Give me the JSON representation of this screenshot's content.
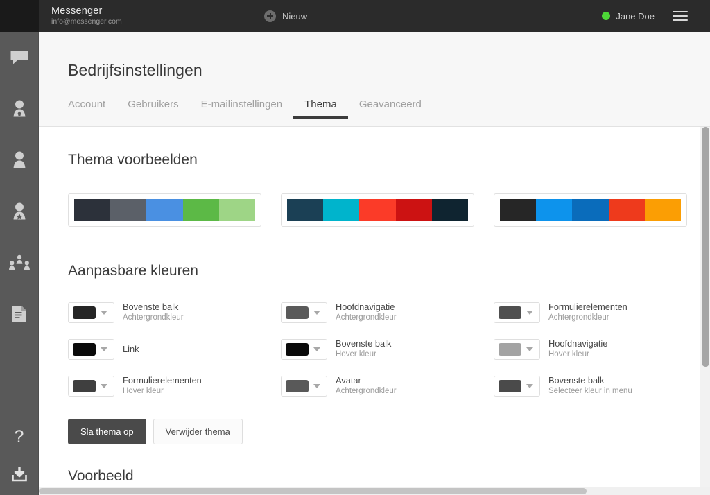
{
  "topbar": {
    "brand_title": "Messenger",
    "brand_email": "info@messenger.com",
    "new_button_label": "Nieuw",
    "new_button_icon": "plus-circle-icon",
    "user_name": "Jane Doe",
    "status_color": "#4dd637",
    "menu_icon": "hamburger-icon",
    "background": "#2b2b2b"
  },
  "sidebar": {
    "background": "#595959",
    "items": [
      {
        "name": "chat-icon",
        "label": "Gesprekken"
      },
      {
        "name": "user-badge-icon",
        "label": "Contactpersoon"
      },
      {
        "name": "user-icon",
        "label": "Gebruiker"
      },
      {
        "name": "user-star-icon",
        "label": "Favoriet"
      },
      {
        "name": "group-icon",
        "label": "Groepen"
      },
      {
        "name": "document-icon",
        "label": "Documenten"
      }
    ],
    "bottom_items": [
      {
        "name": "help-icon",
        "label": "?"
      },
      {
        "name": "download-icon",
        "label": "Download"
      }
    ]
  },
  "header": {
    "page_title": "Bedrijfsinstellingen",
    "tabs": [
      {
        "label": "Account",
        "active": false
      },
      {
        "label": "Gebruikers",
        "active": false
      },
      {
        "label": "E-mailinstellingen",
        "active": false
      },
      {
        "label": "Thema",
        "active": true
      },
      {
        "label": "Geavanceerd",
        "active": false
      }
    ]
  },
  "main": {
    "theme_previews_title": "Thema voorbeelden",
    "theme_previews": [
      {
        "name": "theme-preview-1",
        "colors": [
          "#2c313a",
          "#5b6068",
          "#4a90e2",
          "#5cb946",
          "#9ed586"
        ]
      },
      {
        "name": "theme-preview-2",
        "colors": [
          "#1b4055",
          "#00b4cc",
          "#fb3b28",
          "#cc1212",
          "#0f2430"
        ]
      },
      {
        "name": "theme-preview-3",
        "colors": [
          "#262626",
          "#0d93ec",
          "#0a6cbb",
          "#ee3a1c",
          "#fb9e04"
        ]
      }
    ],
    "custom_colors_title": "Aanpasbare kleuren",
    "pickers": [
      {
        "swatch": "#252525",
        "main": "Bovenste balk",
        "sub": "Achtergrondkleur"
      },
      {
        "swatch": "#5a5a5a",
        "main": "Hoofdnavigatie",
        "sub": "Achtergrondkleur"
      },
      {
        "swatch": "#4f4f4f",
        "main": "Formulierelementen",
        "sub": "Achtergrondkleur"
      },
      {
        "swatch": "#0a0a0a",
        "main": "Link",
        "sub": ""
      },
      {
        "swatch": "#0a0a0a",
        "main": "Bovenste balk",
        "sub": "Hover kleur"
      },
      {
        "swatch": "#a3a3a3",
        "main": "Hoofdnavigatie",
        "sub": "Hover kleur"
      },
      {
        "swatch": "#3f3f3f",
        "main": "Formulierelementen",
        "sub": "Hover kleur"
      },
      {
        "swatch": "#595959",
        "main": "Avatar",
        "sub": "Achtergrondkleur"
      },
      {
        "swatch": "#4a4a4a",
        "main": "Bovenste balk",
        "sub": "Selecteer kleur in menu"
      }
    ],
    "save_button": "Sla thema op",
    "delete_button": "Verwijder thema",
    "next_section_title": "Voorbeeld"
  }
}
